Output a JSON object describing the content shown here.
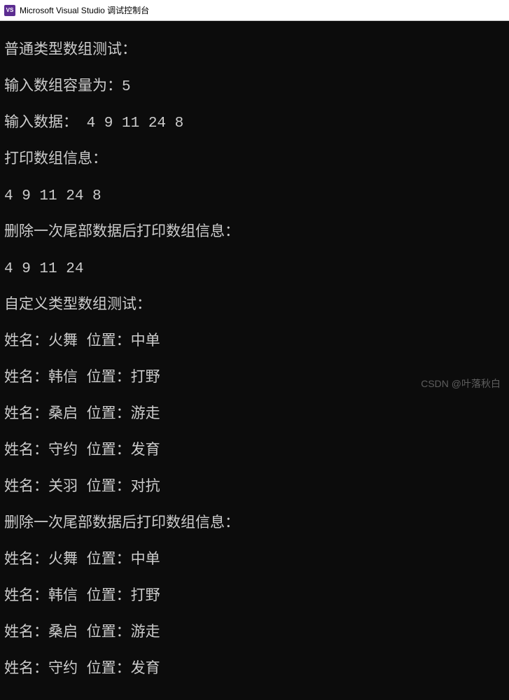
{
  "window": {
    "title": "Microsoft Visual Studio 调试控制台",
    "icon_label": "VS"
  },
  "console": {
    "lines": [
      "普通类型数组测试：",
      "输入数组容量为：5",
      "输入数据： 4 9 11 24 8",
      "打印数组信息：",
      "4 9 11 24 8",
      "删除一次尾部数据后打印数组信息：",
      "4 9 11 24",
      "自定义类型数组测试：",
      "姓名：火舞 位置：中单",
      "姓名：韩信 位置：打野",
      "姓名：桑启 位置：游走",
      "姓名：守约 位置：发育",
      "姓名：关羽 位置：对抗",
      "删除一次尾部数据后打印数组信息：",
      "姓名：火舞 位置：中单",
      "姓名：韩信 位置：打野",
      "姓名：桑启 位置：游走",
      "姓名：守约 位置：发育"
    ]
  },
  "watermark": {
    "text": "CSDN @叶落秋白"
  }
}
